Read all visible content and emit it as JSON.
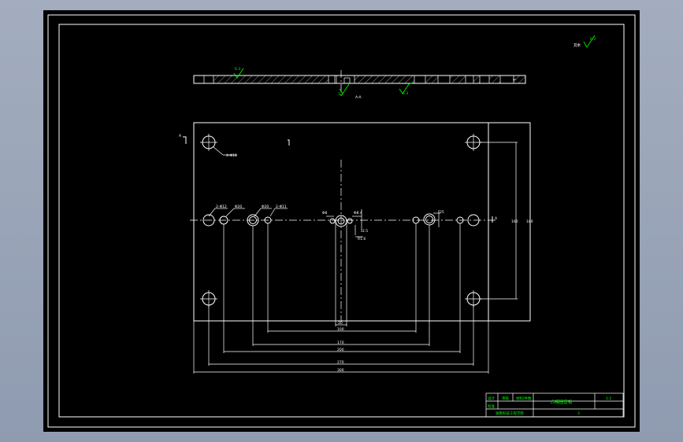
{
  "drawing": {
    "roughness_symbol": "6.3",
    "roughness_note": "其余",
    "section_label": "A-A",
    "section_roughness_1": "6.3",
    "section_roughness_2": "3.2",
    "section_roughness_3": "6.3",
    "hole_label_corner": "4-Φ18",
    "hole_labels_row": [
      "2-Φ12",
      "Φ20",
      "Φ20",
      "2-Φ11"
    ],
    "center_dims": [
      "Φ8",
      "Φ8.4",
      "R1.6",
      "2.5",
      "25"
    ],
    "right_dims": [
      "160",
      "180"
    ],
    "bottom_dims": [
      "20",
      "100",
      "170",
      "200",
      "270",
      "300"
    ],
    "view_mark_left": "A",
    "view_mark_right": "A"
  },
  "title_block": {
    "cell_1": "设计",
    "cell_2": "审核",
    "cell_3": "材料/件数",
    "cell_4": "批准",
    "part_name": "凸模固定板",
    "scale": "1:2",
    "school": "湖南科技工程学院",
    "sheet": "3"
  },
  "colors": {
    "background": "#000000",
    "lines": "#ffffff",
    "annotations": "#00ff00"
  }
}
